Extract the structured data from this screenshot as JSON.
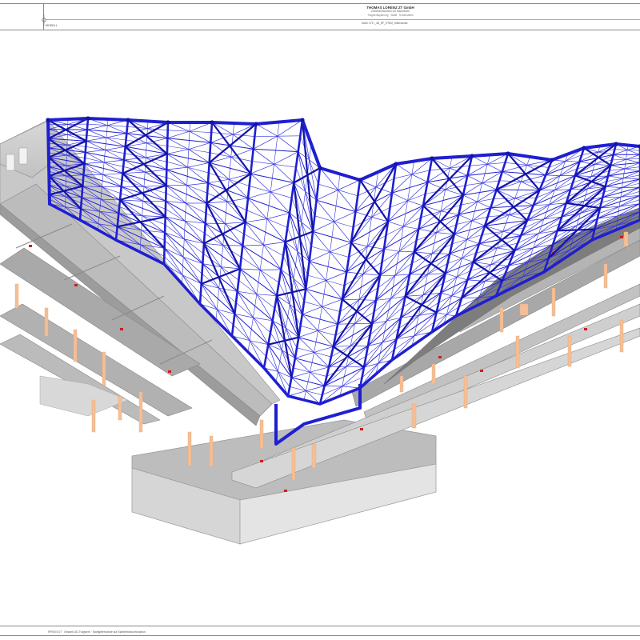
{
  "title_block": {
    "company": "THOMAS LORENZ ZT GmbH",
    "company_line2": "Ziviltechnikerbüro für Bauwesen",
    "company_line3": "Tragwerksplanung · Statik · Konstruktion",
    "file": "Datei: 0717_3D_RF_STEM_Gitterschale",
    "model_label": "MODELL"
  },
  "footer": {
    "text": "RFEM 5.07 · Gesamt-3D-Tragwerk · Stahlgitterschale auf Stahlbetonkonstruktion"
  },
  "colors": {
    "steel_grid": "#1f1fd1",
    "steel_grid_dark": "#1414a8",
    "steel_grid_thin": "#3434e0",
    "concrete_slab": "#c4c4c4",
    "concrete_slab_top": "#b7b7b7",
    "concrete_dark": "#8f8f8f",
    "concrete_light": "#dcdcdc",
    "column": "#f4bf97",
    "support": "#cc1d1d",
    "frame_line": "#8a8a8a"
  },
  "icons": {
    "crosshair": "crosshair-icon"
  }
}
